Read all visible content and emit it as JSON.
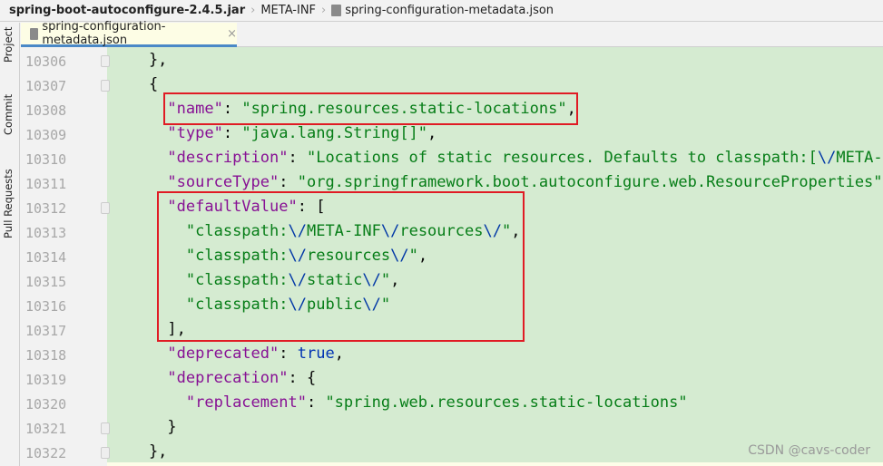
{
  "breadcrumb": {
    "items": [
      "spring-boot-autoconfigure-2.4.5.jar",
      "META-INF",
      "spring-configuration-metadata.json"
    ]
  },
  "sidebar": {
    "items": [
      {
        "label": "Project",
        "icon": "folder-icon"
      },
      {
        "label": "Commit",
        "icon": "commit-icon"
      },
      {
        "label": "Pull Requests",
        "icon": "pull-request-icon"
      }
    ]
  },
  "tab": {
    "label": "spring-configuration-metadata.json",
    "close": "×"
  },
  "colors": {
    "key": "#871094",
    "string": "#067d17",
    "escape": "#0037a6",
    "keyword": "#0033b3",
    "highlight_box": "#e01b24",
    "editor_bg": "#d5ebd1"
  },
  "lines": [
    {
      "n": "10306",
      "t": [
        [
          "p",
          "    },"
        ]
      ]
    },
    {
      "n": "10307",
      "t": [
        [
          "p",
          "    {"
        ]
      ]
    },
    {
      "n": "10308",
      "t": [
        [
          "p",
          "      "
        ],
        [
          "k",
          "\"name\""
        ],
        [
          "p",
          ": "
        ],
        [
          "s",
          "\"spring.resources.static-locations\""
        ],
        [
          "p",
          ","
        ]
      ]
    },
    {
      "n": "10309",
      "t": [
        [
          "p",
          "      "
        ],
        [
          "k",
          "\"type\""
        ],
        [
          "p",
          ": "
        ],
        [
          "s",
          "\"java.lang.String[]\""
        ],
        [
          "p",
          ","
        ]
      ]
    },
    {
      "n": "10310",
      "t": [
        [
          "p",
          "      "
        ],
        [
          "k",
          "\"description\""
        ],
        [
          "p",
          ": "
        ],
        [
          "s",
          "\"Locations of static resources. Defaults to classpath:["
        ],
        [
          "e",
          "\\/"
        ],
        [
          "s",
          "META-INF"
        ]
      ]
    },
    {
      "n": "10311",
      "t": [
        [
          "p",
          "      "
        ],
        [
          "k",
          "\"sourceType\""
        ],
        [
          "p",
          ": "
        ],
        [
          "s",
          "\"org.springframework.boot.autoconfigure.web.ResourceProperties\""
        ],
        [
          "p",
          ","
        ]
      ]
    },
    {
      "n": "10312",
      "t": [
        [
          "p",
          "      "
        ],
        [
          "k",
          "\"defaultValue\""
        ],
        [
          "p",
          ": ["
        ]
      ]
    },
    {
      "n": "10313",
      "t": [
        [
          "p",
          "        "
        ],
        [
          "s",
          "\"classpath:"
        ],
        [
          "e",
          "\\/"
        ],
        [
          "s",
          "META-INF"
        ],
        [
          "e",
          "\\/"
        ],
        [
          "s",
          "resources"
        ],
        [
          "e",
          "\\/"
        ],
        [
          "s",
          "\""
        ],
        [
          "p",
          ","
        ]
      ]
    },
    {
      "n": "10314",
      "t": [
        [
          "p",
          "        "
        ],
        [
          "s",
          "\"classpath:"
        ],
        [
          "e",
          "\\/"
        ],
        [
          "s",
          "resources"
        ],
        [
          "e",
          "\\/"
        ],
        [
          "s",
          "\""
        ],
        [
          "p",
          ","
        ]
      ]
    },
    {
      "n": "10315",
      "t": [
        [
          "p",
          "        "
        ],
        [
          "s",
          "\"classpath:"
        ],
        [
          "e",
          "\\/"
        ],
        [
          "s",
          "static"
        ],
        [
          "e",
          "\\/"
        ],
        [
          "s",
          "\""
        ],
        [
          "p",
          ","
        ]
      ]
    },
    {
      "n": "10316",
      "t": [
        [
          "p",
          "        "
        ],
        [
          "s",
          "\"classpath:"
        ],
        [
          "e",
          "\\/"
        ],
        [
          "s",
          "public"
        ],
        [
          "e",
          "\\/"
        ],
        [
          "s",
          "\""
        ]
      ]
    },
    {
      "n": "10317",
      "t": [
        [
          "p",
          "      ],"
        ]
      ]
    },
    {
      "n": "10318",
      "t": [
        [
          "p",
          "      "
        ],
        [
          "k",
          "\"deprecated\""
        ],
        [
          "p",
          ": "
        ],
        [
          "b",
          "true"
        ],
        [
          "p",
          ","
        ]
      ]
    },
    {
      "n": "10319",
      "t": [
        [
          "p",
          "      "
        ],
        [
          "k",
          "\"deprecation\""
        ],
        [
          "p",
          ": {"
        ]
      ]
    },
    {
      "n": "10320",
      "t": [
        [
          "p",
          "        "
        ],
        [
          "k",
          "\"replacement\""
        ],
        [
          "p",
          ": "
        ],
        [
          "s",
          "\"spring.web.resources.static-locations\""
        ]
      ]
    },
    {
      "n": "10321",
      "t": [
        [
          "p",
          "      }"
        ]
      ]
    },
    {
      "n": "10322",
      "t": [
        [
          "p",
          "    },"
        ]
      ]
    }
  ],
  "watermark": "CSDN @cavs-coder"
}
